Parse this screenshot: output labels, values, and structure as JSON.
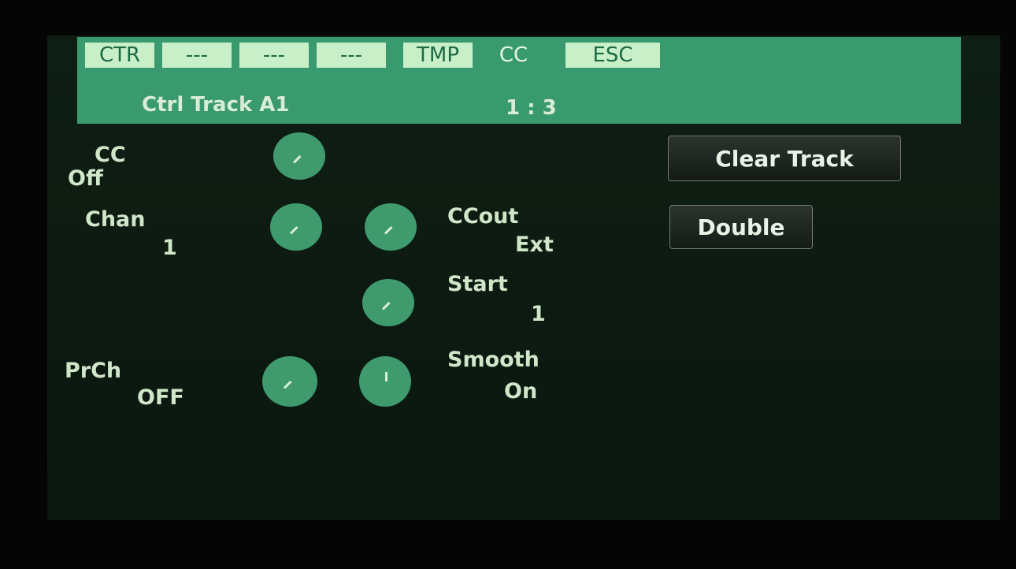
{
  "tabs": [
    "CTR",
    "---",
    "---",
    "---",
    "TMP",
    "CC",
    "ESC"
  ],
  "header": {
    "title": "Ctrl Track A1",
    "position": "1 : 3"
  },
  "params": {
    "cc": {
      "label": "CC",
      "value": "Off"
    },
    "chan": {
      "label": "Chan",
      "value": "1"
    },
    "prch": {
      "label": "PrCh",
      "value": "OFF"
    },
    "ccout": {
      "label": "CCout",
      "value": "Ext"
    },
    "start": {
      "label": "Start",
      "value": "1"
    },
    "smooth": {
      "label": "Smooth",
      "value": "On"
    }
  },
  "buttons": {
    "clear": "Clear Track",
    "double": "Double"
  },
  "colors": {
    "header": "#3a9a6f",
    "tab": "#c9efc9",
    "knob": "#3f9b6d",
    "text": "#cfe6c8"
  }
}
